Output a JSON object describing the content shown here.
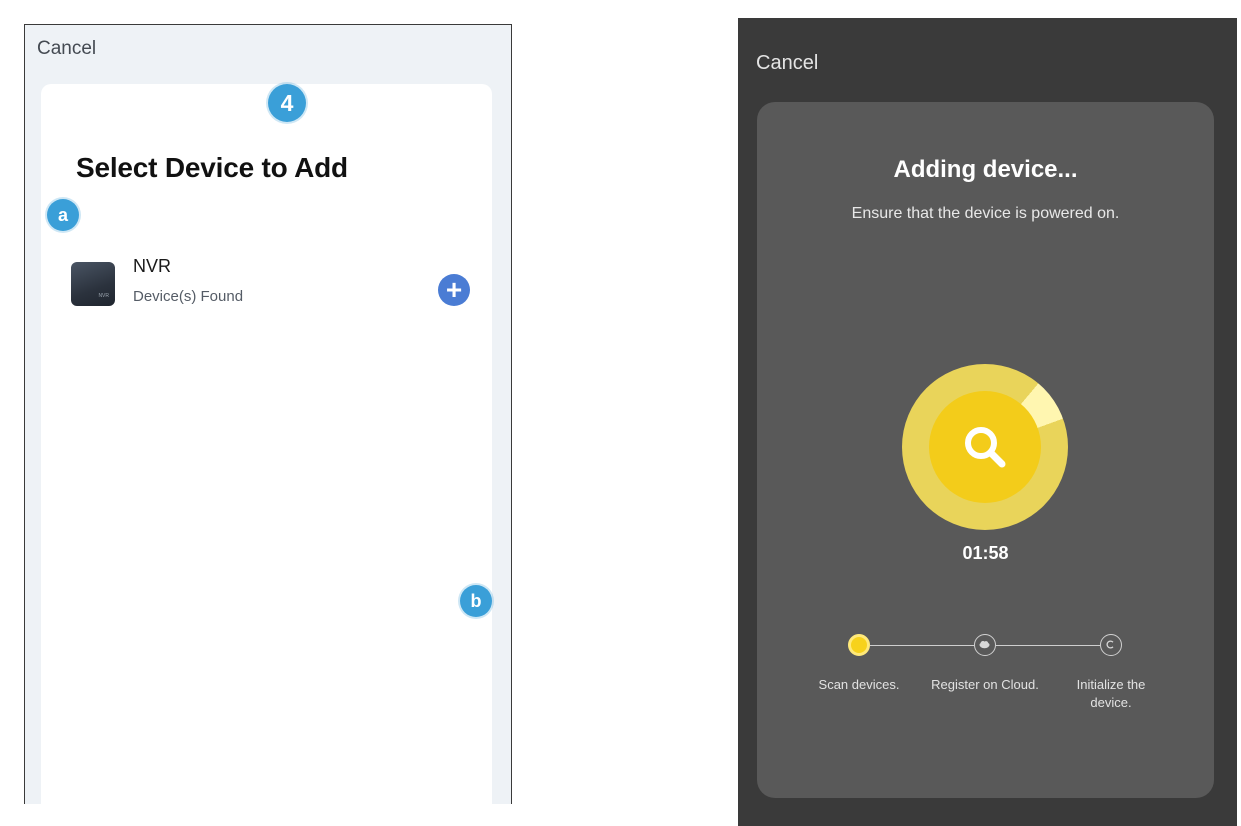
{
  "left_screen": {
    "cancel_label": "Cancel",
    "step_marker": "4",
    "title": "Select Device to Add",
    "marker_a": "a",
    "marker_b": "b",
    "device": {
      "name": "NVR",
      "status": "Device(s) Found",
      "thumb_text": "NVR",
      "add_icon": "plus-circle-icon"
    },
    "colors": {
      "marker": "#3a9fd8",
      "add_button": "#4a7cd4"
    }
  },
  "right_screen": {
    "cancel_label": "Cancel",
    "title": "Adding device...",
    "subtitle": "Ensure that the device is powered on.",
    "timer": "01:58",
    "scan_icon": "search-icon",
    "steps": [
      {
        "label": "Scan devices.",
        "state": "active",
        "icon": "loading-icon"
      },
      {
        "label": "Register on Cloud.",
        "state": "pending",
        "icon": "cloud-icon"
      },
      {
        "label": "Initialize the device.",
        "state": "pending",
        "icon": "copyright-icon"
      }
    ],
    "colors": {
      "background": "#3a3a3a",
      "card": "#595959",
      "accent": "#f3cc1a"
    }
  }
}
